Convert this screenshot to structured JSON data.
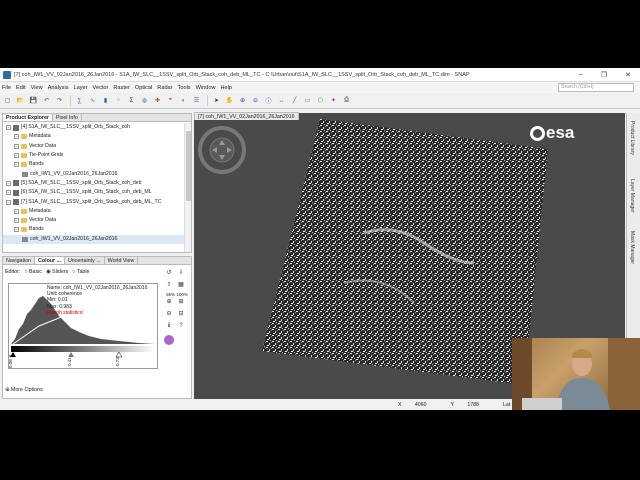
{
  "window": {
    "title": "[7] coh_IW1_VV_02Jan2016_26Jan2016 - S1A_IW_SLC__1SSV_split_Orb_Stack_coh_deb_ML_TC - C:\\Urban\\out\\S1A_IW_SLC__1SSV_split_Orb_Stack_coh_deb_ML_TC.dim - SNAP",
    "controls": [
      "–",
      "❐",
      "✕"
    ]
  },
  "menu": {
    "items": [
      "File",
      "Edit",
      "View",
      "Analysis",
      "Layer",
      "Vector",
      "Raster",
      "Optical",
      "Radar",
      "Tools",
      "Window",
      "Help"
    ],
    "search_placeholder": "Search (Ctrl+I)"
  },
  "toolbar": {
    "icons": [
      "new-product-icon",
      "open-product-icon",
      "save-icon",
      "undo-icon",
      "redo-icon",
      "band-maths-icon",
      "spectrum-icon",
      "histogram-icon",
      "scatter-icon",
      "statistics-icon",
      "world-map-icon",
      "gcp-icon",
      "pin-icon",
      "colour-icon",
      "layer-icon",
      "select-icon",
      "pan-icon",
      "zoom-in-icon",
      "zoom-out-icon",
      "pixel-info-icon",
      "range-finder-icon",
      "draw-line-icon",
      "draw-rect-icon",
      "draw-polygon-icon",
      "magic-wand-icon",
      "screenshot-icon"
    ]
  },
  "explorer": {
    "tabs": [
      "Product Explorer",
      "Pixel Info"
    ],
    "rows": [
      {
        "indent": 0,
        "kind": "product",
        "label": "[4] S1A_IW_SLC__1SSV_split_Orb_Stack_coh"
      },
      {
        "indent": 1,
        "kind": "folder",
        "label": "Metadata"
      },
      {
        "indent": 1,
        "kind": "folder",
        "label": "Vector Data"
      },
      {
        "indent": 1,
        "kind": "folder",
        "label": "Tie-Point Grids"
      },
      {
        "indent": 1,
        "kind": "folder",
        "label": "Bands"
      },
      {
        "indent": 2,
        "kind": "band",
        "label": "coh_IW1_VV_02Jan2016_26Jan2016"
      },
      {
        "indent": 0,
        "kind": "product",
        "label": "[5] S1A_IW_SLC__1SSV_split_Orb_Stack_coh_deb"
      },
      {
        "indent": 0,
        "kind": "product",
        "label": "[6] S1A_IW_SLC__1SSV_split_Orb_Stack_coh_deb_ML"
      },
      {
        "indent": 0,
        "kind": "product",
        "label": "[7] S1A_IW_SLC__1SSV_split_Orb_Stack_coh_deb_ML_TC"
      },
      {
        "indent": 1,
        "kind": "folder",
        "label": "Metadata"
      },
      {
        "indent": 1,
        "kind": "folder",
        "label": "Vector Data"
      },
      {
        "indent": 1,
        "kind": "folder",
        "label": "Bands"
      },
      {
        "indent": 2,
        "kind": "band",
        "label": "coh_IW1_VV_02Jan2016_26Jan2016",
        "selected": true
      }
    ]
  },
  "colour_panel": {
    "tabs": [
      "Navigation",
      "Colour ...",
      "Uncertainty ...",
      "World View"
    ],
    "editor_label": "Editor:",
    "modes": [
      "Basic",
      "Sliders",
      "Table"
    ],
    "selected_mode": "Sliders",
    "info": {
      "name": "Name: coh_IW1_VV_02Jan2016_26Jan2016",
      "unit": "Unit: coherence",
      "min": "Min: 0.01",
      "max": "Max: 0.983",
      "rough": "Rough statistics!"
    },
    "slider_values": [
      "0.0E-3",
      "0.41",
      "0.73"
    ],
    "more_options": "More Options",
    "tool_labels": [
      "95%",
      "100%"
    ]
  },
  "image_view": {
    "tab": "[7] coh_IW1_VV_02Jan2016_26Jan2016",
    "logo": "esa"
  },
  "status": {
    "x_label": "X",
    "x_value": "4060",
    "y_label": "Y",
    "y_value": "1788",
    "lat": "Lat 28°34'17\" N  Lon"
  },
  "right_tabs": [
    "Product Library",
    "Layer Manager",
    "Mask Manager"
  ]
}
